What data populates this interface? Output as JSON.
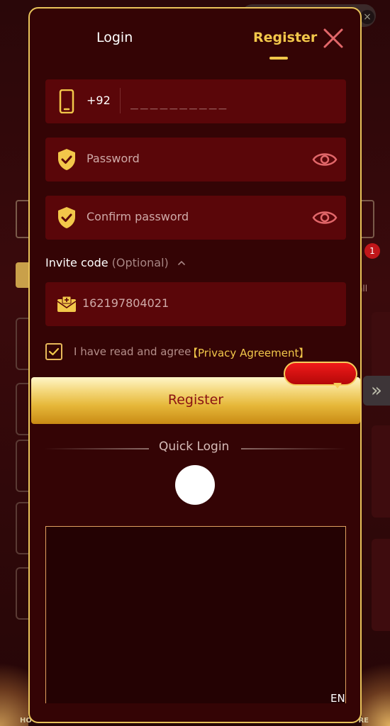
{
  "background": {
    "badge_count": "1",
    "partial_label": "all",
    "nav_left": "HO",
    "nav_right": "RE",
    "chevron": "»"
  },
  "tabs": {
    "login_label": "Login",
    "register_label": "Register",
    "active": "Register"
  },
  "form": {
    "phone": {
      "country_code": "+92",
      "placeholder": "__________",
      "value": "",
      "icon": "phone-icon"
    },
    "password": {
      "placeholder": "Password",
      "icon": "shield-check-icon"
    },
    "confirm_password": {
      "placeholder": "Confirm password",
      "icon": "shield-check-icon"
    },
    "invite": {
      "label": "Invite code",
      "optional_label": "(Optional)",
      "value": "162197804021",
      "icon": "mail-plus-icon"
    },
    "agreement": {
      "checked": true,
      "text": "I have read and agree",
      "link_text": "【Privacy Agreement】"
    },
    "submit_label": "Register"
  },
  "quick_login": {
    "label": "Quick Login"
  },
  "footer": {
    "language": "EN"
  },
  "colors": {
    "accent_gold": "#f2c74a",
    "field_bg": "#5a0609",
    "modal_bg": "#340405",
    "button_text": "#8a1212"
  }
}
